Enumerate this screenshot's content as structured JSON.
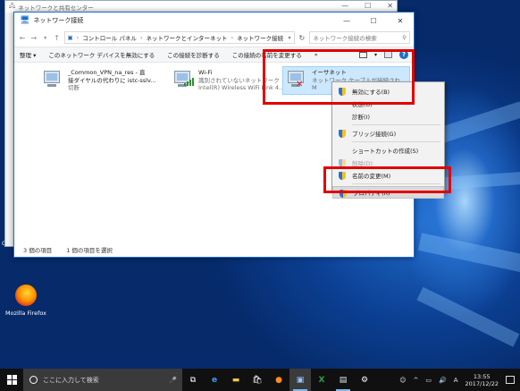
{
  "back_window": {
    "title": "ネットワークと共有センター"
  },
  "window": {
    "title": "ネットワーク接続",
    "breadcrumb": [
      "コントロール パネル",
      "ネットワークとインターネット",
      "ネットワーク接続"
    ],
    "search_placeholder": "ネットワーク接続の検索",
    "commands": [
      "整理 ▾",
      "このネットワーク デバイスを無効にする",
      "この接続を診断する",
      "この接続の名前を変更する",
      "»"
    ],
    "connections": [
      {
        "name": "_Common_VPN_na_res - 直",
        "detail": "接ダイヤルの代わりに istc-sslv...",
        "status": "切断",
        "icon": "vpn-adapter"
      },
      {
        "name": "Wi-Fi",
        "detail": "識別されていないネットワーク",
        "status": "Intel(R) Wireless WiFi Link 4...",
        "icon": "wifi-adapter"
      },
      {
        "name": "イーサネット",
        "detail": "ネットワーク ケーブルが接続され...",
        "status": "M",
        "icon": "ethernet-adapter",
        "selected": true
      }
    ],
    "status": {
      "count": "3 個の項目",
      "selected": "1 個の項目を選択"
    }
  },
  "context_menu": [
    {
      "label": "無効にする(B)",
      "shield": true
    },
    {
      "label": "状態(U)"
    },
    {
      "label": "診断(I)"
    },
    {
      "separator": true
    },
    {
      "label": "ブリッジ接続(G)",
      "shield": true
    },
    {
      "separator": true
    },
    {
      "label": "ショートカットの作成(S)"
    },
    {
      "label": "削除(D)",
      "shield": true,
      "disabled": true
    },
    {
      "label": "名前の変更(M)",
      "shield": true
    },
    {
      "separator": true
    },
    {
      "label": "プロパティ(R)",
      "shield": true,
      "highlighted": true
    }
  ],
  "desktop": {
    "firefox_label": "Mozilla Firefox",
    "left_cut_text": "Co"
  },
  "taskbar": {
    "search_placeholder": "ここに入力して検索",
    "time": "13:55",
    "date": "2017/12/22",
    "ime": "A",
    "apps": [
      "cortana-mic-icon",
      "task-view-icon",
      "edge-icon",
      "file-explorer-icon",
      "store-icon",
      "firefox-icon",
      "network-connections-icon",
      "excel-icon",
      "control-panel-icon",
      "settings-icon"
    ]
  },
  "colors": {
    "highlight_box": "#e10000",
    "accent": "#1c6ec8",
    "selection": "#cce8ff"
  }
}
